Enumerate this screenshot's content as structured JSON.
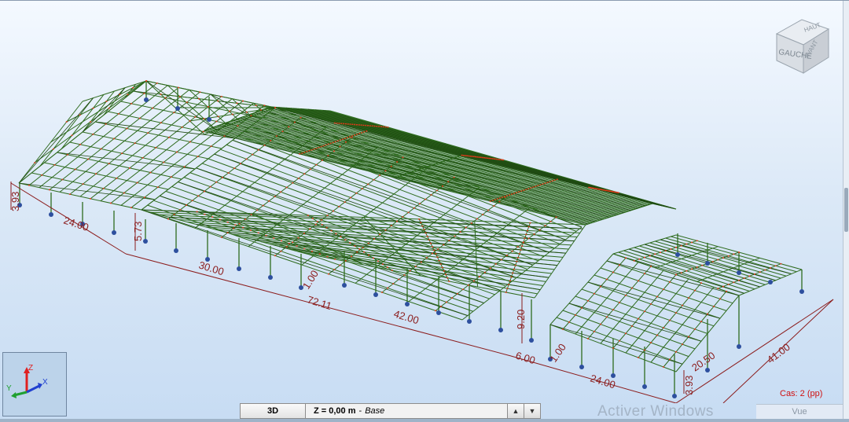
{
  "viewcube": {
    "top": "HAUT",
    "left": "GAUCHE",
    "front": "AVANT"
  },
  "axes": {
    "x": "X",
    "y": "Y",
    "z": "Z"
  },
  "dimensions": {
    "d1": "3.93",
    "d2": "24.00",
    "d3": "5.73",
    "d4": "30.00",
    "d5": "1.00",
    "d6": "72.11",
    "d7": "42.00",
    "d8": "9.20",
    "d9": "6.00",
    "d10": "1.00",
    "d11": "24.00",
    "d12": "3.93",
    "d13": "20.50",
    "d14": "41.00"
  },
  "bottom_bar": {
    "view_mode": "3D",
    "level": "Z = 0,00 m",
    "separator": "-",
    "level_name": "Base",
    "up_arrow": "▲",
    "down_arrow": "▼"
  },
  "case_label": "Cas: 2 (pp)",
  "vue_label": "Vue",
  "watermark": "Activer Windows",
  "colors": {
    "member": "#2e6b1e",
    "member_dark": "#1f4a12",
    "dimension": "#8b1c1c",
    "support": "#2d4f9e",
    "node": "#e03a1a"
  }
}
